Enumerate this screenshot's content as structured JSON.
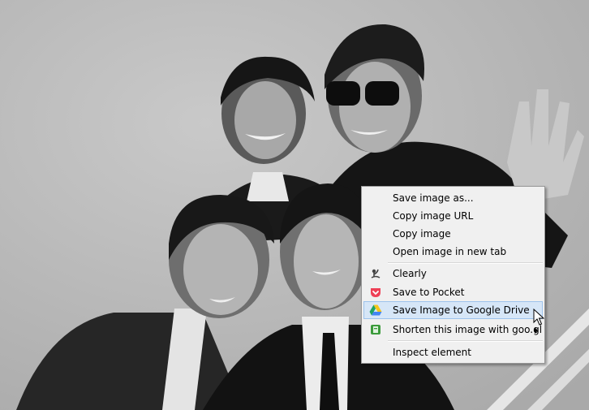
{
  "context_menu": {
    "items": [
      {
        "label": "Save image as..."
      },
      {
        "label": "Copy image URL"
      },
      {
        "label": "Copy image"
      },
      {
        "label": "Open image in new tab"
      },
      {
        "label": "Clearly",
        "icon": "clearly-icon"
      },
      {
        "label": "Save to Pocket",
        "icon": "pocket-icon"
      },
      {
        "label": "Save Image to Google Drive",
        "icon": "google-drive-icon",
        "highlighted": true
      },
      {
        "label": "Shorten this image with goo.gl",
        "icon": "goo-gl-icon",
        "submenu": true
      },
      {
        "label": "Inspect element"
      }
    ],
    "highlight_color": "#d6e6f7"
  }
}
